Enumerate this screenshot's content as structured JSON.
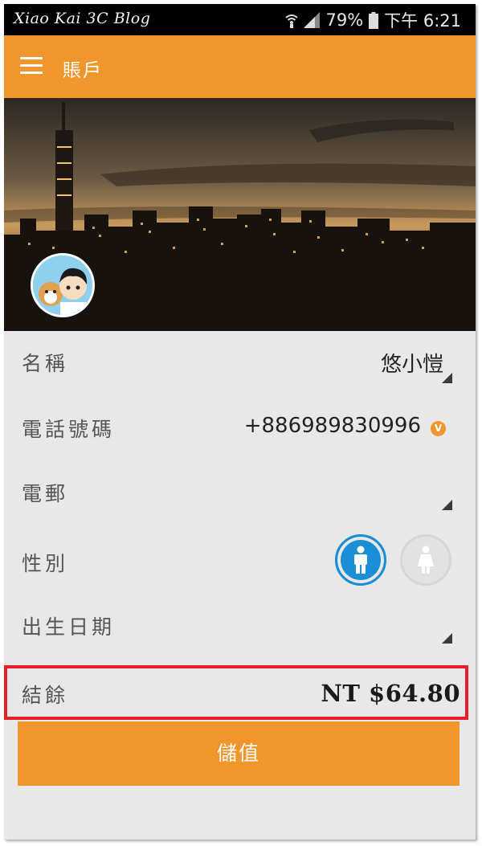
{
  "status_bar": {
    "watermark": "Xiao Kai 3C Blog",
    "battery": "79%",
    "time": "下午 6:21"
  },
  "app_bar": {
    "title": "賬戶"
  },
  "profile": {
    "fields": [
      {
        "label": "名稱",
        "value": "悠小愷"
      },
      {
        "label": "電話號碼",
        "value": "+886989830996",
        "badge": "V"
      },
      {
        "label": "電郵",
        "value": ""
      },
      {
        "label": "性別",
        "selected": "male"
      },
      {
        "label": "出生日期",
        "value": ""
      }
    ],
    "balance": {
      "label": "結餘",
      "value": "NT $64.80"
    }
  },
  "actions": {
    "topup_label": "儲值"
  },
  "colors": {
    "accent": "#f0962d",
    "highlight_border": "#e6202a",
    "gender_selected": "#1a8fd6"
  }
}
